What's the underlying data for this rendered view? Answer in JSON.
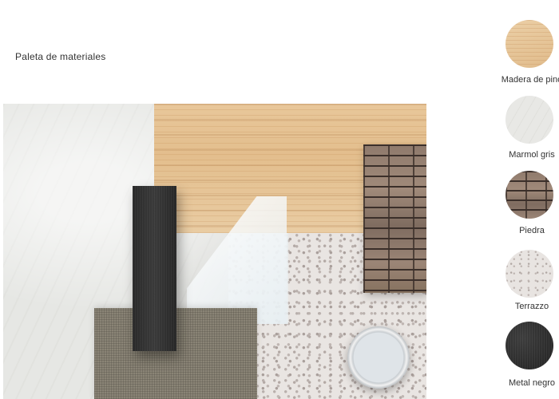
{
  "title": "Paleta de materiales",
  "swatches": [
    {
      "label": "Madera de pino",
      "icon": "wood-swatch",
      "color": "#e6c597"
    },
    {
      "label": "Marmol gris",
      "icon": "marble-swatch",
      "color": "#e8e8e5"
    },
    {
      "label": "Piedra",
      "icon": "stone-swatch",
      "color": "#8f7a6c"
    },
    {
      "label": "Terrazzo",
      "icon": "terrazzo-swatch",
      "color": "#e8e4e1"
    },
    {
      "label": "Metal negro",
      "icon": "metal-swatch",
      "color": "#2a2a2a"
    }
  ]
}
